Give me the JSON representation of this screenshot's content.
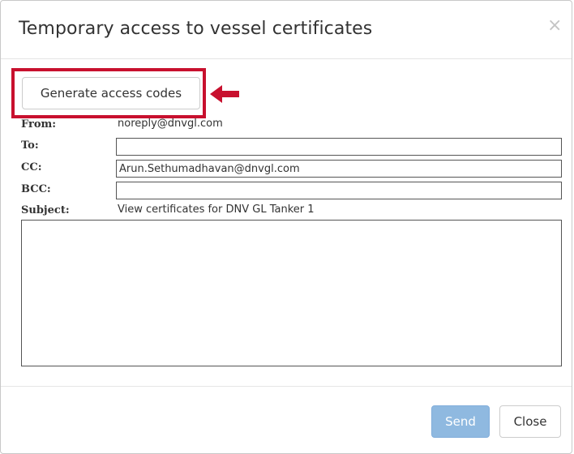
{
  "dialog": {
    "title": "Temporary access to vessel certificates",
    "close_glyph": "×"
  },
  "toolbar": {
    "generate_label": "Generate access codes"
  },
  "annotation": {
    "highlight_color": "#c8102e",
    "arrow_icon": "left-arrow-icon"
  },
  "form": {
    "from_label": "From:",
    "from_value": "noreply@dnvgl.com",
    "to_label": "To:",
    "to_value": "",
    "cc_label": "CC:",
    "cc_value": "Arun.Sethumadhavan@dnvgl.com",
    "bcc_label": "BCC:",
    "bcc_value": "",
    "subject_label": "Subject:",
    "subject_value": "View certificates for DNV GL Tanker 1",
    "body_value": ""
  },
  "footer": {
    "send_label": "Send",
    "close_label": "Close"
  },
  "colors": {
    "send_button": "#8fb9e0",
    "text": "#333333"
  }
}
